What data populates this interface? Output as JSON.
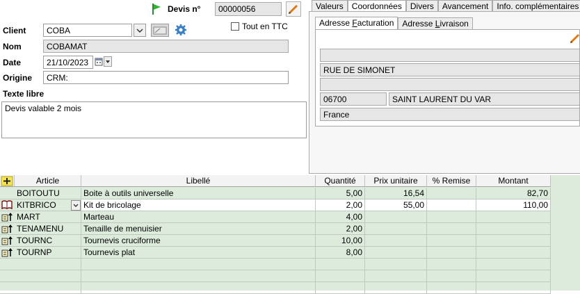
{
  "header": {
    "devis_label": "Devis n°",
    "devis_number": "00000056"
  },
  "form": {
    "client_label": "Client",
    "client_value": "COBA",
    "nom_label": "Nom",
    "nom_value": "COBAMAT",
    "date_label": "Date",
    "date_value": "21/10/2023",
    "origine_label": "Origine",
    "origine_value": "CRM:",
    "ttc_label": "Tout en TTC",
    "ttc_checked": false,
    "texte_libre_label": "Texte libre",
    "texte_libre_value": "Devis valable 2 mois"
  },
  "tabs": [
    {
      "label": "Valeurs",
      "active": false
    },
    {
      "label": "Coordonnées",
      "active": true
    },
    {
      "label": "Divers",
      "active": false
    },
    {
      "label": "Avancement",
      "active": false
    },
    {
      "label": "Info. complémentaires",
      "active": false
    }
  ],
  "address_tabs": [
    {
      "label": "Adresse Facturation",
      "active": true
    },
    {
      "label": "Adresse Livraison",
      "active": false
    }
  ],
  "address": {
    "line1": "",
    "line2": "RUE DE SIMONET",
    "line3": "",
    "postal_code": "06700",
    "city": "SAINT LAURENT DU VAR",
    "country": "France"
  },
  "grid": {
    "columns": [
      "Article",
      "Libellé",
      "Quantité",
      "Prix unitaire",
      "% Remise",
      "Montant"
    ],
    "rows": [
      {
        "article": "BOITOUTU",
        "libelle": "Boite à outils universelle",
        "quantite": "5,00",
        "prix": "16,54",
        "remise": "",
        "montant": "82,70",
        "icon": "none"
      },
      {
        "article": "KITBRICO",
        "libelle": "Kit de bricolage",
        "quantite": "2,00",
        "prix": "55,00",
        "remise": "",
        "montant": "110,00",
        "icon": "book-icon"
      },
      {
        "article": "MART",
        "libelle": "Marteau",
        "quantite": "4,00",
        "prix": "",
        "remise": "",
        "montant": "",
        "icon": "component-arrow-icon"
      },
      {
        "article": "TENAMENU",
        "libelle": "Tenaille de menuisier",
        "quantite": "2,00",
        "prix": "",
        "remise": "",
        "montant": "",
        "icon": "component-arrow-icon"
      },
      {
        "article": "TOURNC",
        "libelle": "Tournevis cruciforme",
        "quantite": "10,00",
        "prix": "",
        "remise": "",
        "montant": "",
        "icon": "component-arrow-icon"
      },
      {
        "article": "TOURNP",
        "libelle": "Tournevis plat",
        "quantite": "8,00",
        "prix": "",
        "remise": "",
        "montant": "",
        "icon": "component-arrow-icon"
      }
    ]
  },
  "colors": {
    "grid_bg": "#dcebdc",
    "flag": "#2db32d",
    "field_ro": "#e6e6e6"
  }
}
